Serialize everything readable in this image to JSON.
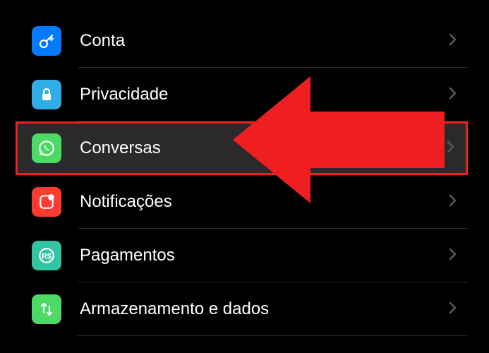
{
  "settings": {
    "items": [
      {
        "id": "account",
        "label": "Conta",
        "icon": "key-icon",
        "color": "#037aff",
        "highlighted": false
      },
      {
        "id": "privacy",
        "label": "Privacidade",
        "icon": "lock-icon",
        "color": "#31ade6",
        "highlighted": false
      },
      {
        "id": "chats",
        "label": "Conversas",
        "icon": "whatsapp-icon",
        "color": "#4cd964",
        "highlighted": true
      },
      {
        "id": "notifications",
        "label": "Notificações",
        "icon": "notification-icon",
        "color": "#ff3b30",
        "highlighted": false
      },
      {
        "id": "payments",
        "label": "Pagamentos",
        "icon": "payments-icon",
        "color": "#32c5a4",
        "highlighted": false
      },
      {
        "id": "storage",
        "label": "Armazenamento e dados",
        "icon": "storage-icon",
        "color": "#4cd964",
        "highlighted": false
      }
    ]
  },
  "annotation": {
    "type": "arrow",
    "color": "#ef1f1f",
    "target": "chats"
  }
}
